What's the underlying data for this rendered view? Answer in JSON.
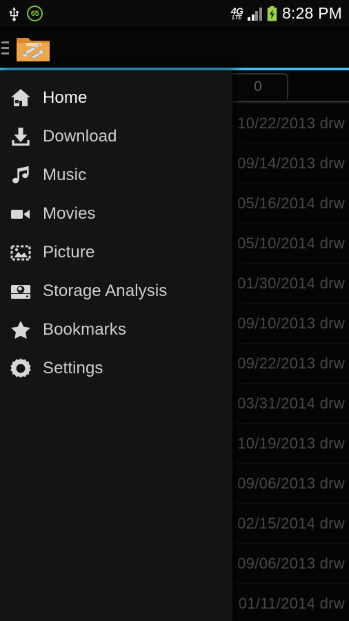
{
  "status_bar": {
    "usb_icon": "usb-icon",
    "battery_percent_badge": "65",
    "network_type_primary": "4G",
    "network_type_secondary": "LTE",
    "signal_icon": "signal-bars-icon",
    "battery_icon": "battery-charging-icon",
    "clock": "8:28 PM"
  },
  "action_bar": {
    "drawer_toggle_icon": "hamburger-menu-icon",
    "app_icon": "folder-tools-icon",
    "accent_color": "#33b5e5"
  },
  "drawer": {
    "items": [
      {
        "label": "Home",
        "icon": "home-icon",
        "selected": true
      },
      {
        "label": "Download",
        "icon": "download-icon",
        "selected": false
      },
      {
        "label": "Music",
        "icon": "music-note-icon",
        "selected": false
      },
      {
        "label": "Movies",
        "icon": "video-camera-icon",
        "selected": false
      },
      {
        "label": "Picture",
        "icon": "picture-frame-icon",
        "selected": false
      },
      {
        "label": "Storage Analysis",
        "icon": "hard-disk-icon",
        "selected": false
      },
      {
        "label": "Bookmarks",
        "icon": "star-icon",
        "selected": false
      },
      {
        "label": "Settings",
        "icon": "gear-icon",
        "selected": false
      }
    ]
  },
  "content": {
    "tab_label": "0",
    "rows": [
      {
        "meta": "10/22/2013 drw"
      },
      {
        "meta": "09/14/2013 drw"
      },
      {
        "meta": "05/16/2014 drw"
      },
      {
        "meta": "05/10/2014 drw"
      },
      {
        "meta": "01/30/2014 drw"
      },
      {
        "meta": "09/10/2013 drw"
      },
      {
        "meta": "09/22/2013 drw"
      },
      {
        "meta": "03/31/2014 drw"
      },
      {
        "meta": "10/19/2013 drw"
      },
      {
        "meta": "09/06/2013 drw"
      },
      {
        "meta": "02/15/2014 drw"
      },
      {
        "meta": "09/06/2013 drw"
      },
      {
        "meta": "01/11/2014 drw"
      }
    ]
  }
}
